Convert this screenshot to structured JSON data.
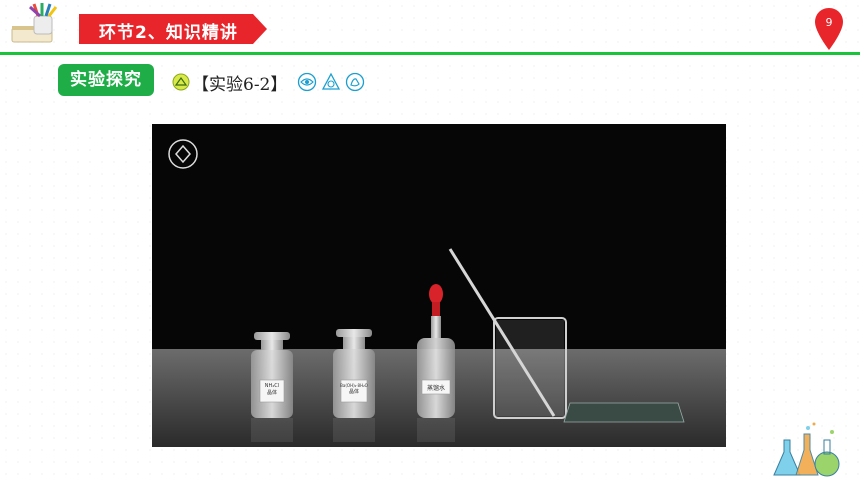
{
  "header": {
    "section_label": "环节2、知识精讲",
    "page_number": "9"
  },
  "experiment": {
    "tag_label": "实验探究",
    "title": "【实验6-2】"
  },
  "video": {
    "bottle1_label_line1": "NH₄Cl",
    "bottle1_label_line2": "晶体",
    "bottle2_label_line1": "Ba(OH)₂·8H₂O",
    "bottle2_label_line2": "晶体",
    "bottle3_label": "蒸馏水"
  },
  "colors": {
    "accent_green": "#1fad48",
    "banner_red": "#e8252a",
    "rule_green": "#18c43a"
  }
}
